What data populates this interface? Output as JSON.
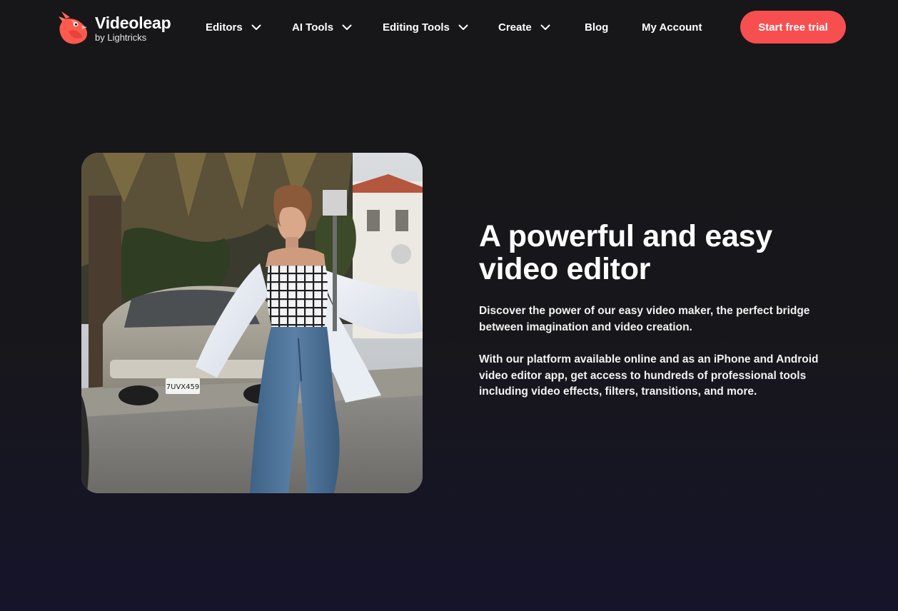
{
  "brand": {
    "name": "Videoleap",
    "sub": "by Lightricks",
    "accent": "#f74f4f"
  },
  "nav": {
    "editors": "Editors",
    "ai_tools": "AI Tools",
    "editing_tools": "Editing Tools",
    "create": "Create",
    "blog": "Blog",
    "my_account": "My Account",
    "cta": "Start free trial"
  },
  "hero": {
    "title_line1": "A powerful and easy",
    "title_line2": "video editor",
    "paragraph1": "Discover the power of our easy video maker, the perfect bridge between imagination and video creation.",
    "paragraph2": "With our platform available online and as an iPhone and Android video editor app, get access to hundreds of professional tools including video effects, filters, transitions, and more.",
    "image": {
      "plate": "7UVX459"
    }
  },
  "icons": {
    "logo": "videoleap-bird-logo",
    "dropdown": "chevron-down-icon"
  },
  "colors": {
    "background": "#17171a",
    "button": "#f74f4f",
    "text": "#ffffff"
  }
}
